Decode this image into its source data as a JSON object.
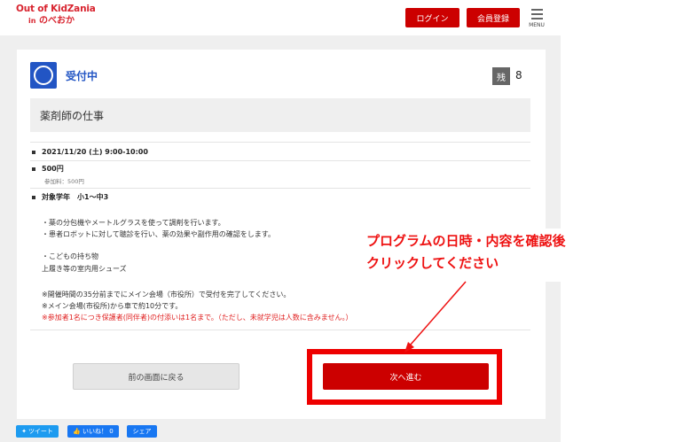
{
  "header": {
    "logo_line1": "Out of KidZania",
    "logo_in": "in",
    "logo_city": "のべおか",
    "login_label": "ログイン",
    "register_label": "会員登録",
    "menu_label": "MENU"
  },
  "program": {
    "status": "受付中",
    "remaining_label": "残",
    "remaining_count": "8",
    "title": "薬剤師の仕事",
    "datetime": "2021/11/20 (土) 9:00-10:00",
    "price": "500円",
    "fee_note": "参加料：500円",
    "target": "対象学年　小1〜中3",
    "description": [
      "・薬の分包機やメートルグラスを使って調剤を行います。",
      "・患者ロボットに対して聴診を行い、薬の効果や副作用の確認をします。"
    ],
    "belongings_title": "・こどもの持ち物",
    "belongings": "上履き等の室内用シューズ",
    "notes": [
      "※開催時間の35分前までにメイン会場（市役所）で受付を完了してください。",
      "※メイン会場(市役所)から車で約10分です。"
    ],
    "note_red": "※参加者1名につき保護者(同伴者)の付添いは1名まで。（ただし、未就学児は人数に含みません。）"
  },
  "actions": {
    "back_label": "前の画面に戻る",
    "next_label": "次へ進む"
  },
  "annotation": {
    "line1": "プログラムの日時・内容を確認後",
    "line2": "クリックしてください"
  },
  "social": {
    "tweet_label": "ツイート",
    "like_label": "いいね！ 0",
    "share_label": "シェア"
  },
  "colors": {
    "brand_red": "#cc0000",
    "status_blue": "#2255c4",
    "annotation_red": "#ee1111"
  }
}
